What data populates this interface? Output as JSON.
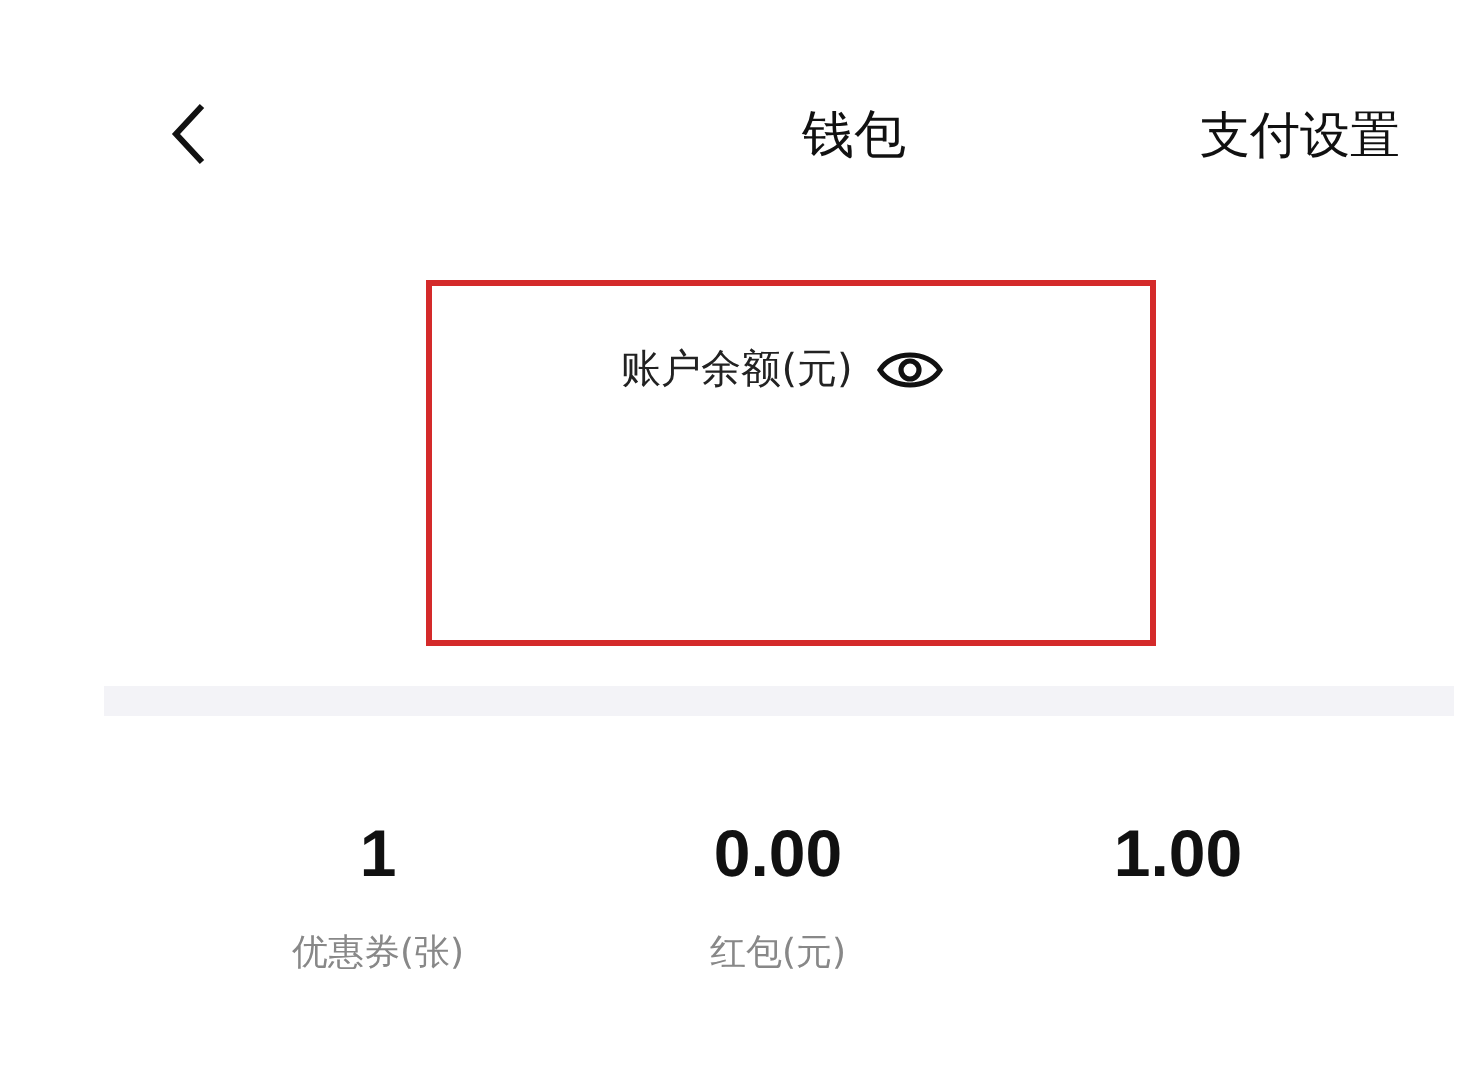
{
  "header": {
    "title": "钱包",
    "action": "支付设置"
  },
  "balance": {
    "label": "账户余额(元)"
  },
  "stats": [
    {
      "value": "1",
      "label": "优惠券(张)"
    },
    {
      "value": "0.00",
      "label": "红包(元)"
    },
    {
      "value": "1.00"
    }
  ]
}
